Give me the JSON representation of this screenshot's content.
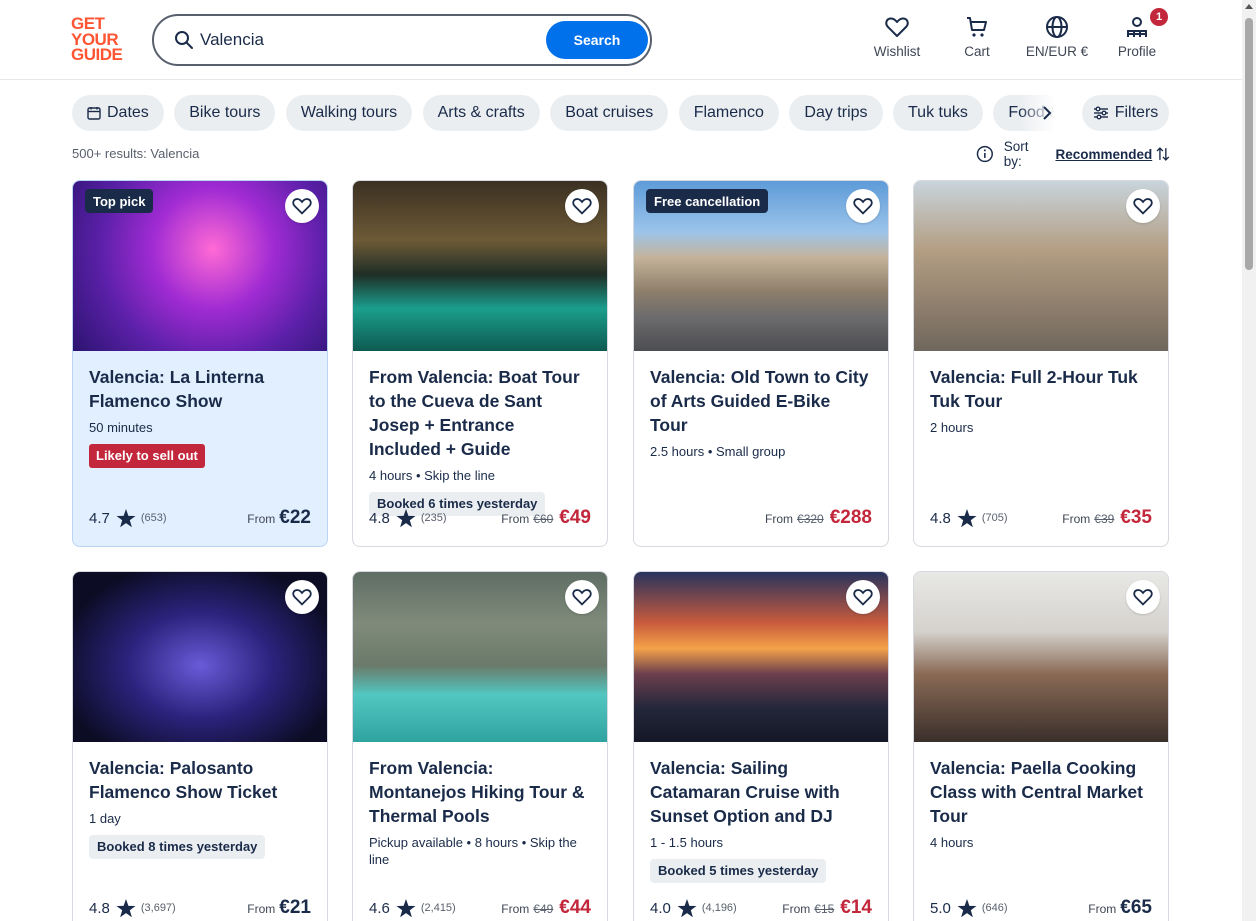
{
  "brand": {
    "logo_lines": [
      "GET",
      "YOUR",
      "GUIDE"
    ],
    "accent": "#ff5533"
  },
  "search": {
    "value": "Valencia",
    "button_label": "Search"
  },
  "header_nav": [
    {
      "label": "Wishlist",
      "icon": "heart-icon"
    },
    {
      "label": "Cart",
      "icon": "cart-icon"
    },
    {
      "label": "EN/EUR €",
      "icon": "globe-icon"
    },
    {
      "label": "Profile",
      "icon": "profile-icon",
      "badge": "1"
    }
  ],
  "chips": [
    "Dates",
    "Bike tours",
    "Walking tours",
    "Arts & crafts",
    "Boat cruises",
    "Flamenco",
    "Day trips",
    "Tuk tuks",
    "Food &"
  ],
  "filters_label": "Filters",
  "results_text": "500+ results: Valencia",
  "sort": {
    "label": "Sort by:",
    "value": "Recommended"
  },
  "cards": [
    {
      "tag": "Top pick",
      "title": "Valencia: La Linterna Flamenco Show",
      "meta": "50 minutes",
      "sell_label": "Likely to sell out",
      "rating": "4.7",
      "reviews": "(653)",
      "from": "From",
      "price": "€22",
      "sale": false
    },
    {
      "title": "From Valencia: Boat Tour to the Cueva de Sant Josep + Entrance Included + Guide",
      "meta": "4 hours • Skip the line",
      "booked": "Booked 6 times yesterday",
      "rating": "4.8",
      "reviews": "(235)",
      "from": "From",
      "old_price": "€60",
      "price": "€49",
      "sale": true
    },
    {
      "tag": "Free cancellation",
      "title": "Valencia: Old Town to City of Arts Guided E-Bike Tour",
      "meta": "2.5 hours • Small group",
      "from": "From",
      "old_price": "€320",
      "price": "€288",
      "sale": true
    },
    {
      "title": "Valencia: Full 2-Hour Tuk Tuk Tour",
      "meta": "2 hours",
      "rating": "4.8",
      "reviews": "(705)",
      "from": "From",
      "old_price": "€39",
      "price": "€35",
      "sale": true
    },
    {
      "title": "Valencia: Palosanto Flamenco Show Ticket",
      "meta": "1 day",
      "booked": "Booked 8 times yesterday",
      "rating": "4.8",
      "reviews": "(3,697)",
      "from": "From",
      "price": "€21",
      "sale": false
    },
    {
      "title": "From Valencia: Montanejos Hiking Tour & Thermal Pools",
      "meta": "Pickup available • 8 hours • Skip the line",
      "rating": "4.6",
      "reviews": "(2,415)",
      "from": "From",
      "old_price": "€49",
      "price": "€44",
      "sale": true
    },
    {
      "title": "Valencia: Sailing Catamaran Cruise with Sunset Option and DJ",
      "meta": "1 - 1.5 hours",
      "booked": "Booked 5 times yesterday",
      "rating": "4.0",
      "reviews": "(4,196)",
      "from": "From",
      "old_price": "€15",
      "price": "€14",
      "sale": true
    },
    {
      "title": "Valencia: Paella Cooking Class with Central Market Tour",
      "meta": "4 hours",
      "rating": "5.0",
      "reviews": "(646)",
      "from": "From",
      "price": "€65",
      "sale": false
    }
  ]
}
